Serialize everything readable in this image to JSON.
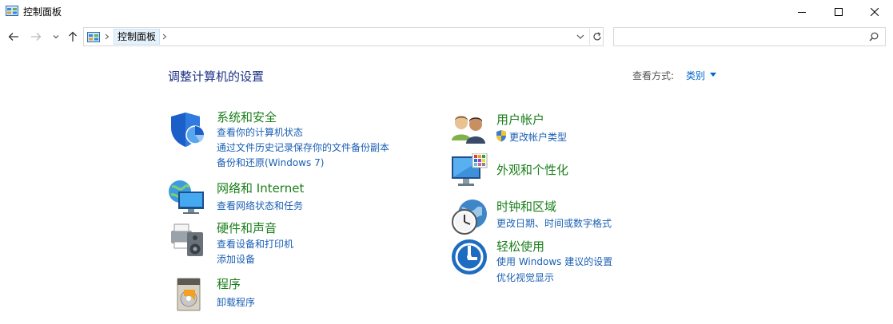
{
  "window": {
    "title": "控制面板"
  },
  "navbar": {
    "breadcrumb": "控制面板",
    "search_placeholder": ""
  },
  "main": {
    "heading": "调整计算机的设置",
    "view_by_label": "查看方式:",
    "view_by_value": "类别"
  },
  "categories": {
    "system": {
      "title": "系统和安全",
      "links": [
        "查看你的计算机状态",
        "通过文件历史记录保存你的文件备份副本",
        "备份和还原(Windows 7)"
      ]
    },
    "network": {
      "title": "网络和 Internet",
      "links": [
        "查看网络状态和任务"
      ]
    },
    "hardware": {
      "title": "硬件和声音",
      "links": [
        "查看设备和打印机",
        "添加设备"
      ]
    },
    "programs": {
      "title": "程序",
      "links": [
        "卸载程序"
      ]
    },
    "users": {
      "title": "用户帐户",
      "links": [
        "更改帐户类型"
      ]
    },
    "appearance": {
      "title": "外观和个性化",
      "links": []
    },
    "clock": {
      "title": "时钟和区域",
      "links": [
        "更改日期、时间或数字格式"
      ]
    },
    "ease": {
      "title": "轻松使用",
      "links": [
        "使用 Windows 建议的设置",
        "优化视觉显示"
      ]
    }
  },
  "icons": {
    "app": "control-panel-icon",
    "back": "arrow-left-icon",
    "forward": "arrow-right-icon",
    "recent": "chevron-down-icon",
    "up": "arrow-up-icon",
    "refresh": "refresh-icon",
    "search": "search-icon"
  },
  "colors": {
    "heading": "#1e3287",
    "category_title": "#1a7e1a",
    "link": "#1a5fb4"
  }
}
